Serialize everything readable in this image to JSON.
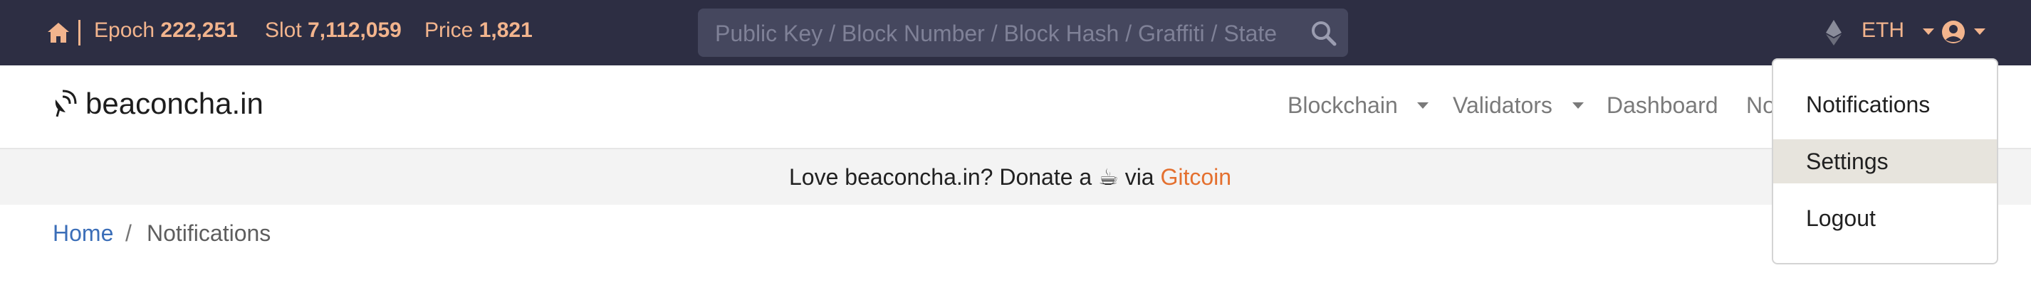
{
  "topbar": {
    "epoch_label": "Epoch",
    "epoch_value": "222,251",
    "slot_label": "Slot",
    "slot_value": "7,112,059",
    "price_label": "Price",
    "price_value": "1,821",
    "search_placeholder": "Public Key / Block Number / Block Hash / Graffiti / State",
    "currency": "ETH"
  },
  "navbar": {
    "brand": "beaconcha.in",
    "items": [
      {
        "label": "Blockchain"
      },
      {
        "label": "Validators"
      },
      {
        "label": "Dashboard"
      },
      {
        "label": "No"
      }
    ]
  },
  "banner": {
    "text_before": "Love beaconcha.in? Donate a ",
    "emoji": "☕",
    "text_mid": " via ",
    "link": "Gitcoin"
  },
  "breadcrumb": {
    "home": "Home",
    "separator": "/",
    "current": "Notifications"
  },
  "user_menu": {
    "items": [
      {
        "label": "Notifications"
      },
      {
        "label": "Settings"
      },
      {
        "label": "Logout"
      }
    ]
  },
  "colors": {
    "topbar_bg": "#2d2e43",
    "accent": "#f2b48d",
    "link_orange": "#e4702f",
    "link_blue": "#3b6eb8"
  }
}
